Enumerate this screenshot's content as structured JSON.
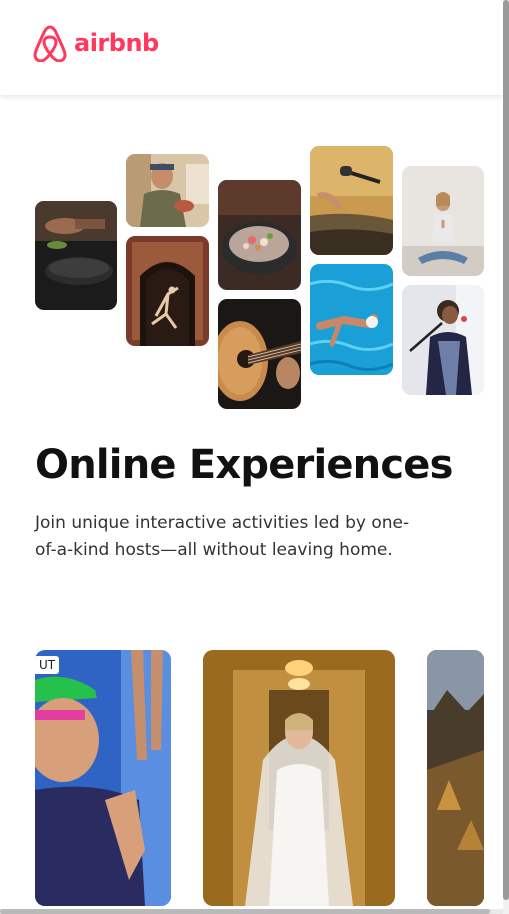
{
  "brand": {
    "name": "airbnb",
    "color": "#ff385c",
    "logo_icon": "airbnb-belo-icon"
  },
  "hero": {
    "title": "Online Experiences",
    "subtitle": "Join unique interactive activities led by one-of-a-kind hosts—all without leaving home."
  },
  "collage": [
    "cooking-photo",
    "chef-portrait-photo",
    "dancer-archway-photo",
    "food-bowl-photo",
    "guitar-photo",
    "microphone-photo",
    "swimmer-photo",
    "yoga-photo",
    "singer-photo"
  ],
  "cards": [
    {
      "badge": "UT",
      "image": "athlete-swim-cap-photo"
    },
    {
      "badge": "",
      "image": "bride-veil-photo"
    },
    {
      "badge": "",
      "image": "mountain-landscape-photo"
    }
  ]
}
